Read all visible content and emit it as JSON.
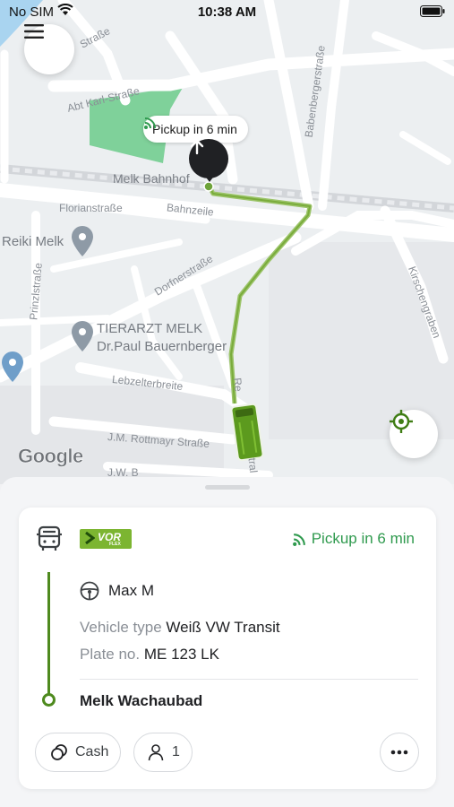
{
  "status_bar": {
    "carrier": "No SIM",
    "time": "10:38 AM"
  },
  "map": {
    "pickup_chip_label": "Pickup in 6 min",
    "street_labels": {
      "abt_karl_strasse": "Abt Karl-Straße",
      "strasse_top": "Straße",
      "babenbergerstrasse": "Babenbergerstraße",
      "melk_bahnhof": "Melk Bahnhof",
      "florianstrasse": "Florianstraße",
      "bahnzeile": "Bahnzeile",
      "dorfnerstrasse": "Dorfnerstraße",
      "prinzlstrasse": "Prinzlstraße",
      "lebzelterbreite": "Lebzelterbreite",
      "rottmayr": "J.M. Rottmayr Straße",
      "jw_b": "J.W. B",
      "kirschengraben": "Kirschengraben",
      "re": "Re",
      "tral": "tral"
    },
    "places": {
      "reiki": "Reiki Melk",
      "tierarzt_line1": "TIERARZT MELK",
      "tierarzt_line2": "Dr.Paul Bauernberger"
    },
    "attribution": "Google"
  },
  "card": {
    "operator_logo_text": "VOR",
    "operator_logo_subtext": "FLEX",
    "pickup_label": "Pickup in 6 min",
    "driver_name": "Max M",
    "vehicle_type_label": "Vehicle type",
    "vehicle_type_value": "Weiß VW Transit",
    "plate_label": "Plate no.",
    "plate_value": "ME 123 LK",
    "destination": "Melk Wachaubad",
    "payment_label": "Cash",
    "passenger_count": "1"
  },
  "colors": {
    "accent_green": "#2f9a4e",
    "route_green": "#4e8a1e",
    "vor_green": "#7cb531"
  }
}
